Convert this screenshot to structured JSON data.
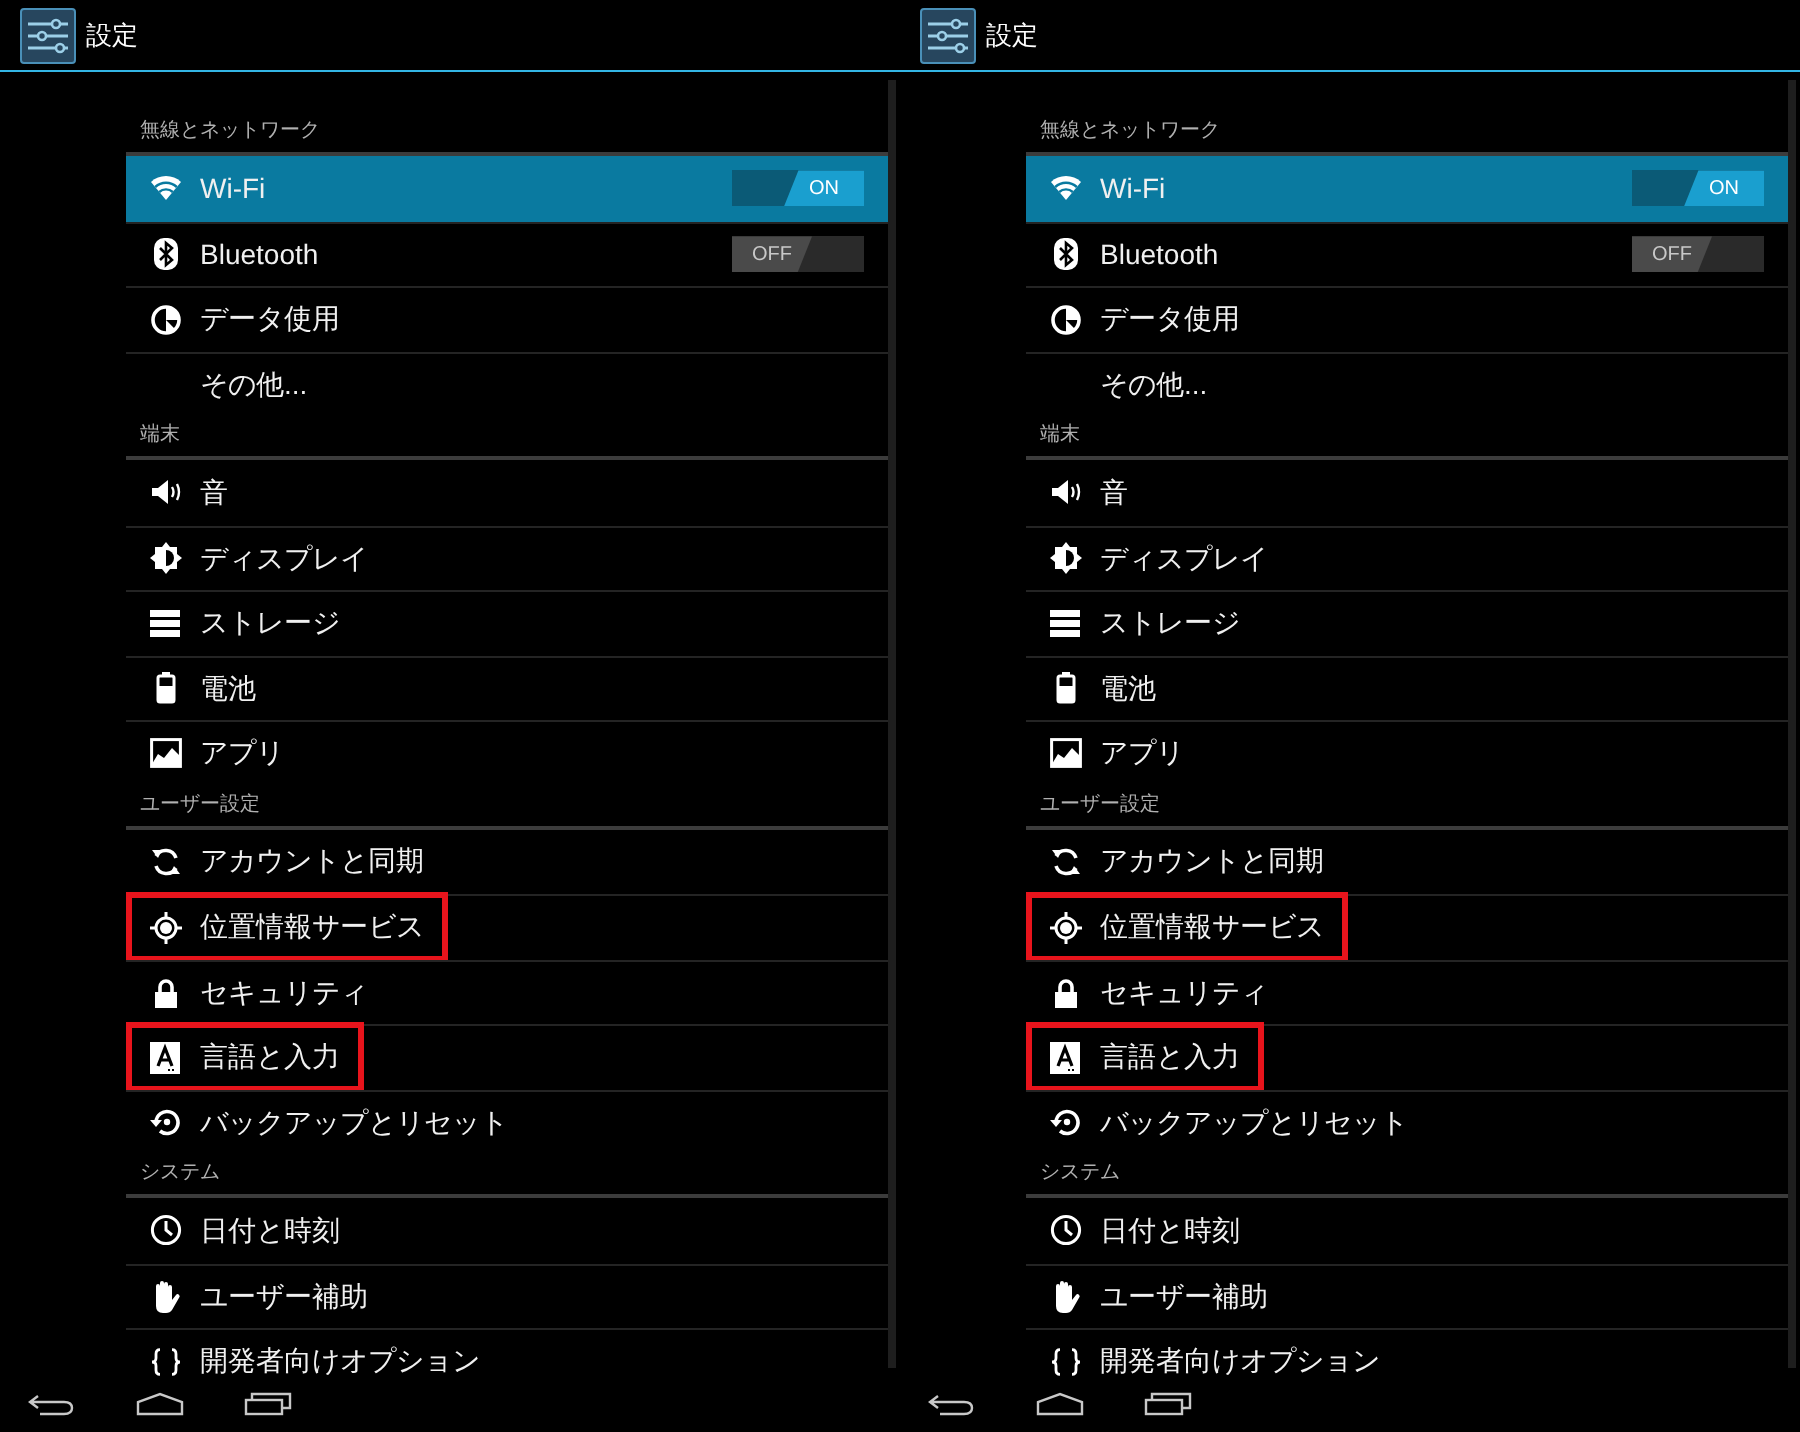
{
  "screens": [
    {
      "title": "設定",
      "sections": [
        {
          "header": "無線とネットワーク",
          "items": [
            {
              "label": "Wi-Fi",
              "kind": "wifi",
              "selected": true,
              "marked": false,
              "toggle": {
                "on": true,
                "label": "ON"
              }
            },
            {
              "label": "Bluetooth",
              "kind": "bluetooth",
              "selected": false,
              "marked": false,
              "toggle": {
                "on": false,
                "label": "OFF"
              }
            },
            {
              "label": "データ使用",
              "kind": "data",
              "selected": false,
              "marked": false
            },
            {
              "label": "その他...",
              "kind": "plain",
              "selected": false,
              "marked": false
            }
          ]
        },
        {
          "header": "端末",
          "items": [
            {
              "label": "音",
              "kind": "sound",
              "selected": false,
              "marked": false
            },
            {
              "label": "ディスプレイ",
              "kind": "display",
              "selected": false,
              "marked": false
            },
            {
              "label": "ストレージ",
              "kind": "storage",
              "selected": false,
              "marked": false
            },
            {
              "label": "電池",
              "kind": "battery",
              "selected": false,
              "marked": false
            },
            {
              "label": "アプリ",
              "kind": "apps",
              "selected": false,
              "marked": false
            }
          ]
        },
        {
          "header": "ユーザー設定",
          "items": [
            {
              "label": "アカウントと同期",
              "kind": "sync",
              "selected": false,
              "marked": false
            },
            {
              "label": "位置情報サービス",
              "kind": "location",
              "selected": false,
              "marked": true
            },
            {
              "label": "セキュリティ",
              "kind": "lock",
              "selected": false,
              "marked": false
            },
            {
              "label": "言語と入力",
              "kind": "language",
              "selected": false,
              "marked": true
            },
            {
              "label": "バックアップとリセット",
              "kind": "backup",
              "selected": false,
              "marked": false
            }
          ]
        },
        {
          "header": "システム",
          "items": [
            {
              "label": "日付と時刻",
              "kind": "clock",
              "selected": false,
              "marked": false
            },
            {
              "label": "ユーザー補助",
              "kind": "hand",
              "selected": false,
              "marked": false
            },
            {
              "label": "開発者向けオプション",
              "kind": "braces",
              "selected": false,
              "marked": false
            }
          ]
        }
      ]
    },
    {
      "title": "設定",
      "sections": [
        {
          "header": "無線とネットワーク",
          "items": [
            {
              "label": "Wi-Fi",
              "kind": "wifi",
              "selected": true,
              "marked": false,
              "toggle": {
                "on": true,
                "label": "ON"
              }
            },
            {
              "label": "Bluetooth",
              "kind": "bluetooth",
              "selected": false,
              "marked": false,
              "toggle": {
                "on": false,
                "label": "OFF"
              }
            },
            {
              "label": "データ使用",
              "kind": "data",
              "selected": false,
              "marked": false
            },
            {
              "label": "その他...",
              "kind": "plain",
              "selected": false,
              "marked": false
            }
          ]
        },
        {
          "header": "端末",
          "items": [
            {
              "label": "音",
              "kind": "sound",
              "selected": false,
              "marked": false
            },
            {
              "label": "ディスプレイ",
              "kind": "display",
              "selected": false,
              "marked": false
            },
            {
              "label": "ストレージ",
              "kind": "storage",
              "selected": false,
              "marked": false
            },
            {
              "label": "電池",
              "kind": "battery",
              "selected": false,
              "marked": false
            },
            {
              "label": "アプリ",
              "kind": "apps",
              "selected": false,
              "marked": false
            }
          ]
        },
        {
          "header": "ユーザー設定",
          "items": [
            {
              "label": "アカウントと同期",
              "kind": "sync",
              "selected": false,
              "marked": false
            },
            {
              "label": "位置情報サービス",
              "kind": "location",
              "selected": false,
              "marked": true
            },
            {
              "label": "セキュリティ",
              "kind": "lock",
              "selected": false,
              "marked": false
            },
            {
              "label": "言語と入力",
              "kind": "language",
              "selected": false,
              "marked": true
            },
            {
              "label": "バックアップとリセット",
              "kind": "backup",
              "selected": false,
              "marked": false
            }
          ]
        },
        {
          "header": "システム",
          "items": [
            {
              "label": "日付と時刻",
              "kind": "clock",
              "selected": false,
              "marked": false
            },
            {
              "label": "ユーザー補助",
              "kind": "hand",
              "selected": false,
              "marked": false
            },
            {
              "label": "開発者向けオプション",
              "kind": "braces",
              "selected": false,
              "marked": false
            }
          ]
        }
      ]
    }
  ]
}
